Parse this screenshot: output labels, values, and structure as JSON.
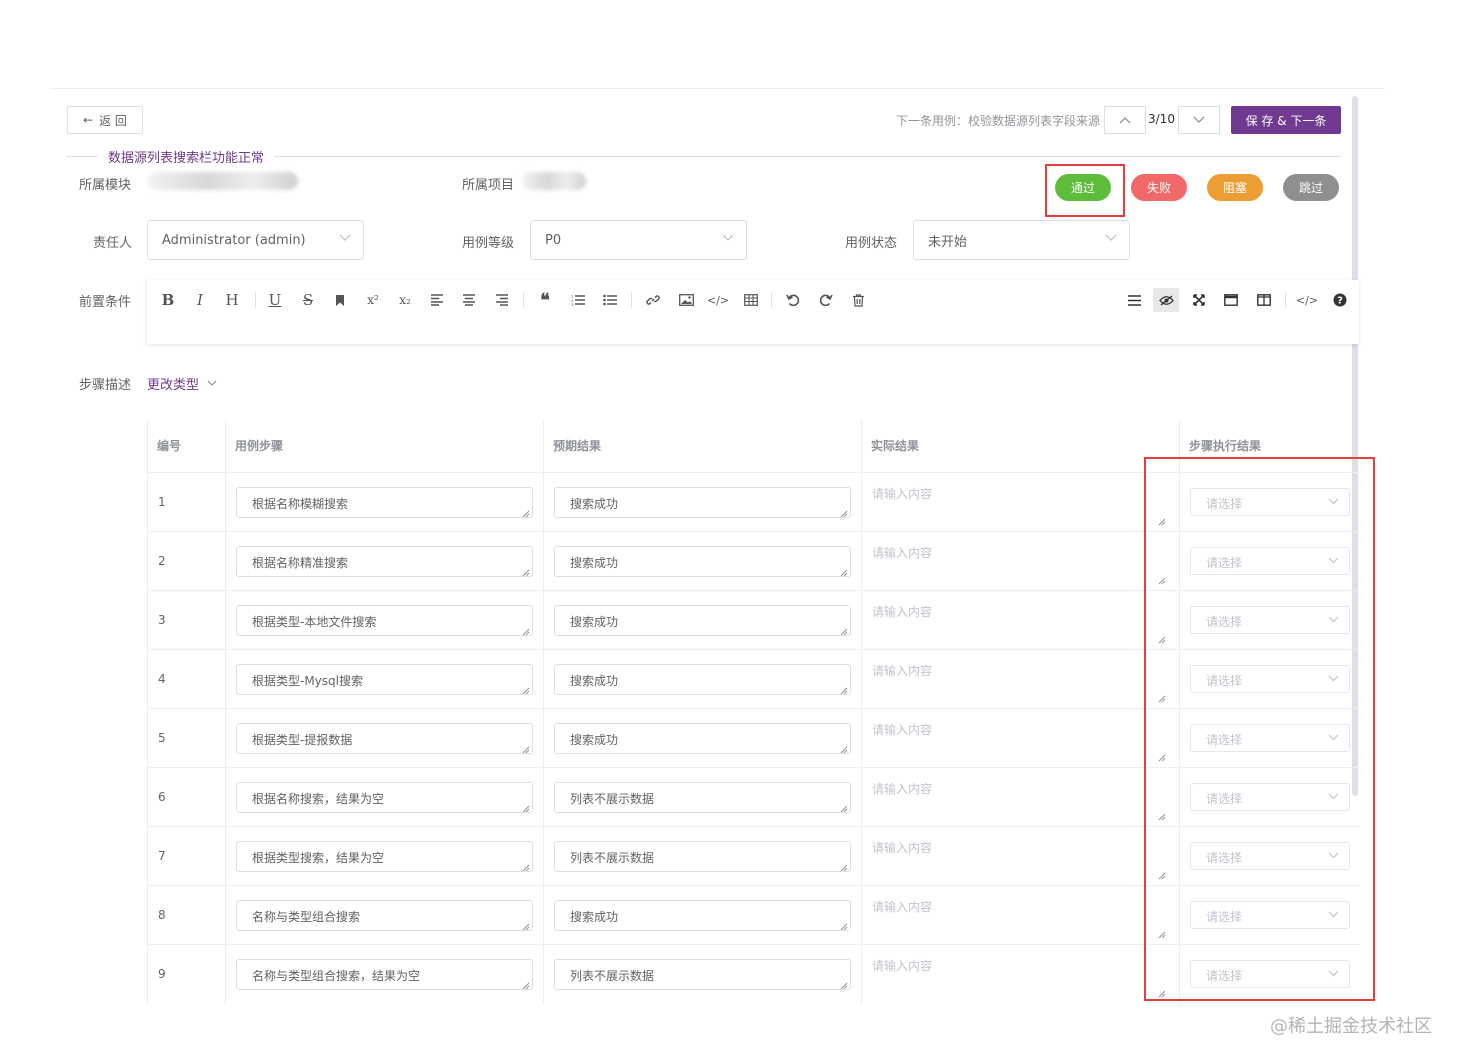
{
  "header": {
    "back_label": "返 回",
    "next_case_text": "下一条用例：校验数据源列表字段来源",
    "counter": "3/10",
    "save_next_label": "保 存 & 下一条"
  },
  "case": {
    "title": "数据源列表搜索栏功能正常",
    "module_label": "所属模块",
    "project_label": "所属项目",
    "owner_label": "责任人",
    "owner_value": "Administrator (admin)",
    "level_label": "用例等级",
    "level_value": "P0",
    "status_label": "用例状态",
    "status_value": "未开始",
    "precondition_label": "前置条件"
  },
  "status_buttons": {
    "pass": "通过",
    "fail": "失败",
    "block": "阻塞",
    "skip": "跳过",
    "colors": {
      "pass": "#5dbd3b",
      "fail": "#f06868",
      "block": "#ec9d34",
      "skip": "#8f8f8f"
    }
  },
  "editor": {
    "icons": [
      "bold-icon",
      "italic-icon",
      "heading-icon",
      "underline-icon",
      "strikethrough-icon",
      "bookmark-icon",
      "superscript-icon",
      "subscript-icon",
      "align-left-icon",
      "align-center-icon",
      "align-right-icon",
      "quote-icon",
      "ordered-list-icon",
      "unordered-list-icon",
      "link-icon",
      "image-icon",
      "code-icon",
      "table-icon",
      "undo-icon",
      "redo-icon",
      "trash-icon",
      "menu-icon",
      "preview-icon",
      "fullscreen-icon",
      "window-icon",
      "split-icon",
      "html-code-icon",
      "help-icon"
    ]
  },
  "steps": {
    "label": "步骤描述",
    "change_type": "更改类型",
    "headers": [
      "编号",
      "用例步骤",
      "预期结果",
      "实际结果",
      "步骤执行结果"
    ],
    "actual_placeholder": "请输入内容",
    "result_placeholder": "请选择",
    "rows": [
      {
        "no": "1",
        "step": "根据名称模糊搜索",
        "expected": "搜索成功"
      },
      {
        "no": "2",
        "step": "根据名称精准搜索",
        "expected": "搜索成功"
      },
      {
        "no": "3",
        "step": "根据类型-本地文件搜索",
        "expected": "搜索成功"
      },
      {
        "no": "4",
        "step": "根据类型-Mysql搜索",
        "expected": "搜索成功"
      },
      {
        "no": "5",
        "step": "根据类型-提报数据",
        "expected": "搜索成功"
      },
      {
        "no": "6",
        "step": "根据名称搜索，结果为空",
        "expected": "列表不展示数据"
      },
      {
        "no": "7",
        "step": "根据类型搜索，结果为空",
        "expected": "列表不展示数据"
      },
      {
        "no": "8",
        "step": "名称与类型组合搜索",
        "expected": "搜索成功"
      },
      {
        "no": "9",
        "step": "名称与类型组合搜索，结果为空",
        "expected": "列表不展示数据"
      }
    ]
  },
  "watermark": "@稀土掘金技术社区",
  "colors": {
    "accent": "#6f3a8f",
    "highlight": "#e53e3e"
  }
}
